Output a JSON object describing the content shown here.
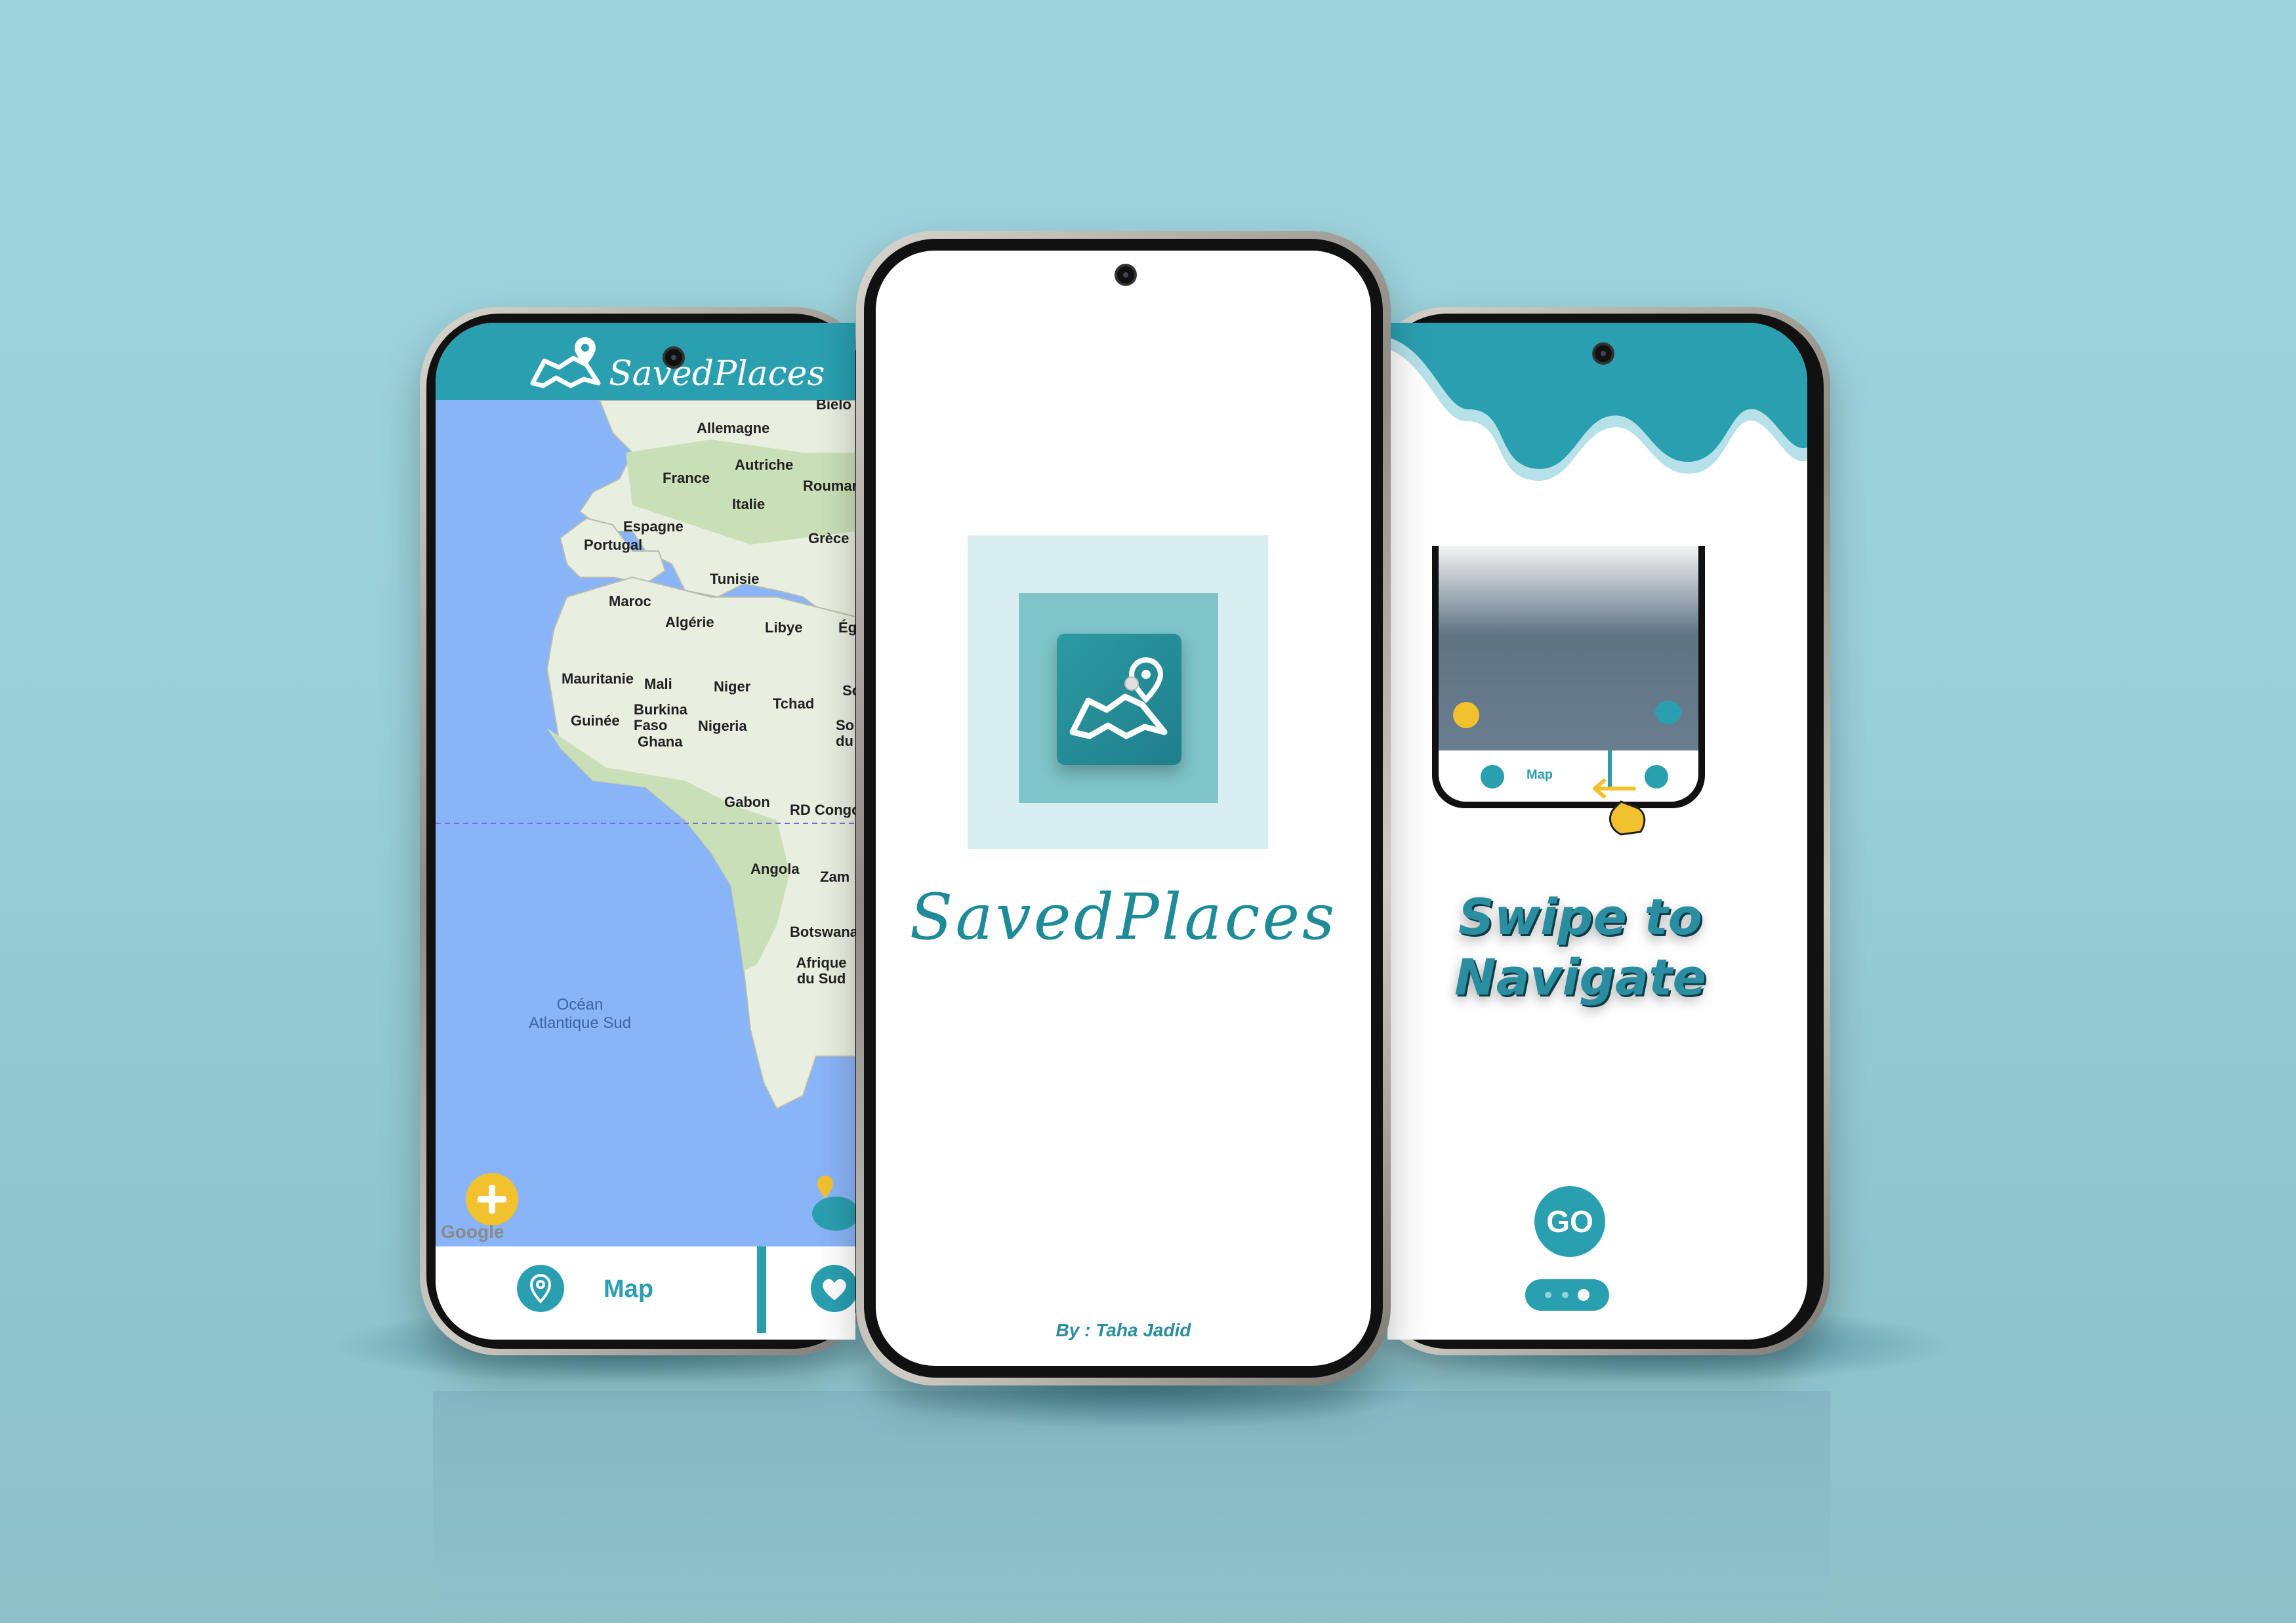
{
  "app_name": "SavedPlaces",
  "colors": {
    "primary": "#2a9fb0",
    "accent_yellow": "#f2c12e",
    "background": "#9ad0da"
  },
  "left_screen": {
    "header_title": "SavedPlaces",
    "map_labels": [
      "Allemagne",
      "France",
      "Autriche",
      "Italie",
      "Roumani",
      "Espagne",
      "Portugal",
      "Grèce",
      "Tunisie",
      "Maroc",
      "Algérie",
      "Libye",
      "Ég",
      "Mauritanie",
      "Mali",
      "Niger",
      "Tchad",
      "So",
      "Burkina Faso",
      "Guinée",
      "Nigeria",
      "Ghana",
      "Gabon",
      "RD Congo",
      "Angola",
      "Zam",
      "Botswana",
      "Afrique du Sud",
      "Bielo",
      "So du"
    ],
    "ocean_label": "Océan Atlantique Sud",
    "google_mark": "Google",
    "nav": {
      "map_label": "Map",
      "pin_icon": "map-pin-icon",
      "heart_icon": "heart-icon"
    },
    "fab_icon": "plus-icon"
  },
  "center_screen": {
    "title": "SavedPlaces",
    "byline": "By : Taha Jadid",
    "logo_icon": "folded-map-pin-icon"
  },
  "right_screen": {
    "headline": "Swipe to Navigate",
    "go_label": "GO",
    "mini_nav_label": "Map",
    "pager": {
      "count": 3,
      "active": 3
    }
  }
}
